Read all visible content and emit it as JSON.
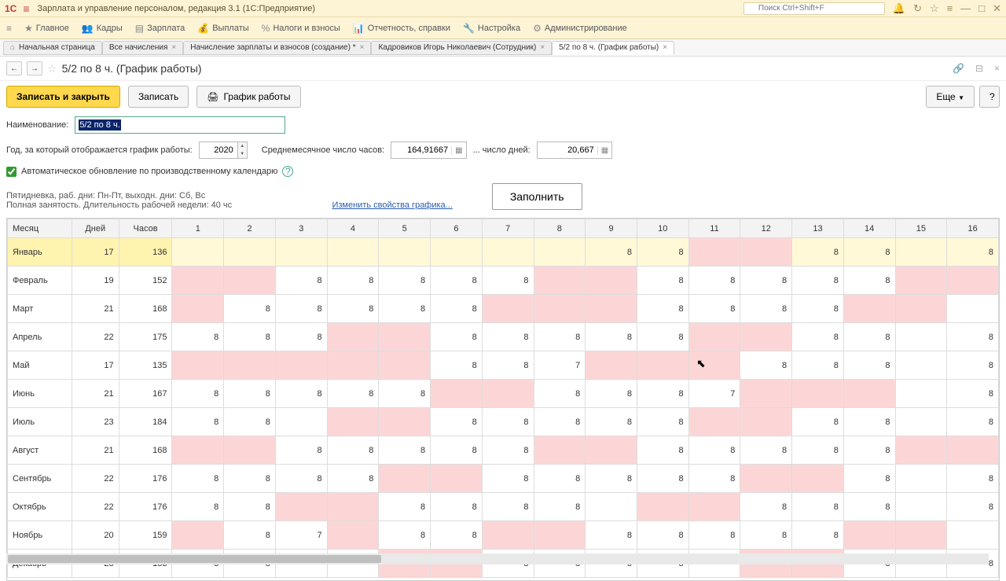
{
  "titlebar": {
    "title": "Зарплата и управление персоналом, редакция 3.1  (1С:Предприятие)",
    "search_placeholder": "Поиск Ctrl+Shift+F"
  },
  "menu": {
    "main": "Главное",
    "kadry": "Кадры",
    "zarplata": "Зарплата",
    "vyplaty": "Выплаты",
    "nalogi": "Налоги и взносы",
    "otchet": "Отчетность, справки",
    "nastr": "Настройка",
    "admin": "Администрирование"
  },
  "tabs": {
    "t0_label": "Начальная страница",
    "t1": "Все начисления",
    "t2": "Начисление зарплаты и взносов (создание) *",
    "t3": "Кадровиков Игорь Николаевич (Сотрудник)",
    "t4": "5/2 по 8 ч. (График работы)"
  },
  "page_title": "5/2 по 8 ч. (График работы)",
  "buttons": {
    "save_close": "Записать и закрыть",
    "save": "Записать",
    "schedule": "График работы",
    "more": "Еще",
    "help": "?",
    "fill": "Заполнить"
  },
  "labels": {
    "name": "Наименование:",
    "year": "Год, за который отображается график работы:",
    "avg_hours": "Среднемесячное число часов:",
    "avg_days": "... число дней:",
    "auto_update": "Автоматическое обновление по производственному календарю",
    "change_props": "Изменить свойства графика..."
  },
  "values": {
    "name": "5/2 по 8 ч.",
    "year": "2020",
    "avg_hours": "164,91667",
    "avg_days": "20,667"
  },
  "info": {
    "line1": "Пятидневка, раб. дни: Пн-Пт, выходн. дни: Сб, Вс",
    "line2": "Полная занятость. Длительность рабочей недели: 40 чс"
  },
  "headers": {
    "month": "Месяц",
    "days": "Дней",
    "hours": "Часов"
  },
  "day_cols": [
    "1",
    "2",
    "3",
    "4",
    "5",
    "6",
    "7",
    "8",
    "9",
    "10",
    "11",
    "12",
    "13",
    "14",
    "15",
    "16"
  ],
  "rows": [
    {
      "m": "Январь",
      "d": "17",
      "h": "136",
      "cells": [
        {
          "v": "",
          "w": false
        },
        {
          "v": "",
          "w": false
        },
        {
          "v": "",
          "w": false
        },
        {
          "v": "",
          "w": false
        },
        {
          "v": "",
          "w": false
        },
        {
          "v": "",
          "w": false
        },
        {
          "v": "",
          "w": false
        },
        {
          "v": "",
          "w": false
        },
        {
          "v": "8",
          "w": false
        },
        {
          "v": "8",
          "w": false
        },
        {
          "v": "",
          "w": true
        },
        {
          "v": "",
          "w": true
        },
        {
          "v": "8",
          "w": false
        },
        {
          "v": "8",
          "w": false
        },
        {
          "v": "",
          "w": false
        },
        {
          "v": "8",
          "w": false
        }
      ],
      "sel": true
    },
    {
      "m": "Февраль",
      "d": "19",
      "h": "152",
      "cells": [
        {
          "v": "",
          "w": true
        },
        {
          "v": "",
          "w": true
        },
        {
          "v": "8",
          "w": false
        },
        {
          "v": "8",
          "w": false
        },
        {
          "v": "8",
          "w": false
        },
        {
          "v": "8",
          "w": false
        },
        {
          "v": "8",
          "w": false
        },
        {
          "v": "",
          "w": true
        },
        {
          "v": "",
          "w": true
        },
        {
          "v": "8",
          "w": false
        },
        {
          "v": "8",
          "w": false
        },
        {
          "v": "8",
          "w": false
        },
        {
          "v": "8",
          "w": false
        },
        {
          "v": "8",
          "w": false
        },
        {
          "v": "",
          "w": true
        },
        {
          "v": "",
          "w": true
        }
      ]
    },
    {
      "m": "Март",
      "d": "21",
      "h": "168",
      "cells": [
        {
          "v": "",
          "w": true
        },
        {
          "v": "8",
          "w": false
        },
        {
          "v": "8",
          "w": false
        },
        {
          "v": "8",
          "w": false
        },
        {
          "v": "8",
          "w": false
        },
        {
          "v": "8",
          "w": false
        },
        {
          "v": "",
          "w": true
        },
        {
          "v": "",
          "w": true
        },
        {
          "v": "",
          "w": true
        },
        {
          "v": "8",
          "w": false
        },
        {
          "v": "8",
          "w": false
        },
        {
          "v": "8",
          "w": false
        },
        {
          "v": "8",
          "w": false
        },
        {
          "v": "",
          "w": true
        },
        {
          "v": "",
          "w": true
        },
        {
          "v": "",
          "w": false
        }
      ]
    },
    {
      "m": "Апрель",
      "d": "22",
      "h": "175",
      "cells": [
        {
          "v": "8",
          "w": false
        },
        {
          "v": "8",
          "w": false
        },
        {
          "v": "8",
          "w": false
        },
        {
          "v": "",
          "w": true
        },
        {
          "v": "",
          "w": true
        },
        {
          "v": "8",
          "w": false
        },
        {
          "v": "8",
          "w": false
        },
        {
          "v": "8",
          "w": false
        },
        {
          "v": "8",
          "w": false
        },
        {
          "v": "8",
          "w": false
        },
        {
          "v": "",
          "w": true
        },
        {
          "v": "",
          "w": true
        },
        {
          "v": "8",
          "w": false
        },
        {
          "v": "8",
          "w": false
        },
        {
          "v": "",
          "w": false
        },
        {
          "v": "8",
          "w": false
        }
      ]
    },
    {
      "m": "Май",
      "d": "17",
      "h": "135",
      "cells": [
        {
          "v": "",
          "w": true
        },
        {
          "v": "",
          "w": true
        },
        {
          "v": "",
          "w": true
        },
        {
          "v": "",
          "w": true
        },
        {
          "v": "",
          "w": true
        },
        {
          "v": "8",
          "w": false
        },
        {
          "v": "8",
          "w": false
        },
        {
          "v": "7",
          "w": false
        },
        {
          "v": "",
          "w": true
        },
        {
          "v": "",
          "w": true
        },
        {
          "v": "",
          "w": true
        },
        {
          "v": "8",
          "w": false
        },
        {
          "v": "8",
          "w": false
        },
        {
          "v": "8",
          "w": false
        },
        {
          "v": "",
          "w": false
        },
        {
          "v": "8",
          "w": false
        }
      ]
    },
    {
      "m": "Июнь",
      "d": "21",
      "h": "167",
      "cells": [
        {
          "v": "8",
          "w": false
        },
        {
          "v": "8",
          "w": false
        },
        {
          "v": "8",
          "w": false
        },
        {
          "v": "8",
          "w": false
        },
        {
          "v": "8",
          "w": false
        },
        {
          "v": "",
          "w": true
        },
        {
          "v": "",
          "w": true
        },
        {
          "v": "8",
          "w": false
        },
        {
          "v": "8",
          "w": false
        },
        {
          "v": "8",
          "w": false
        },
        {
          "v": "7",
          "w": false
        },
        {
          "v": "",
          "w": true
        },
        {
          "v": "",
          "w": true
        },
        {
          "v": "",
          "w": true
        },
        {
          "v": "",
          "w": false
        },
        {
          "v": "8",
          "w": false
        }
      ]
    },
    {
      "m": "Июль",
      "d": "23",
      "h": "184",
      "cells": [
        {
          "v": "8",
          "w": false
        },
        {
          "v": "8",
          "w": false
        },
        {
          "v": "",
          "w": false
        },
        {
          "v": "",
          "w": true
        },
        {
          "v": "",
          "w": true
        },
        {
          "v": "8",
          "w": false
        },
        {
          "v": "8",
          "w": false
        },
        {
          "v": "8",
          "w": false
        },
        {
          "v": "8",
          "w": false
        },
        {
          "v": "8",
          "w": false
        },
        {
          "v": "",
          "w": true
        },
        {
          "v": "",
          "w": true
        },
        {
          "v": "8",
          "w": false
        },
        {
          "v": "8",
          "w": false
        },
        {
          "v": "",
          "w": false
        },
        {
          "v": "8",
          "w": false
        }
      ]
    },
    {
      "m": "Август",
      "d": "21",
      "h": "168",
      "cells": [
        {
          "v": "",
          "w": true
        },
        {
          "v": "",
          "w": true
        },
        {
          "v": "8",
          "w": false
        },
        {
          "v": "8",
          "w": false
        },
        {
          "v": "8",
          "w": false
        },
        {
          "v": "8",
          "w": false
        },
        {
          "v": "8",
          "w": false
        },
        {
          "v": "",
          "w": true
        },
        {
          "v": "",
          "w": true
        },
        {
          "v": "8",
          "w": false
        },
        {
          "v": "8",
          "w": false
        },
        {
          "v": "8",
          "w": false
        },
        {
          "v": "8",
          "w": false
        },
        {
          "v": "8",
          "w": false
        },
        {
          "v": "",
          "w": true
        },
        {
          "v": "",
          "w": true
        }
      ]
    },
    {
      "m": "Сентябрь",
      "d": "22",
      "h": "176",
      "cells": [
        {
          "v": "8",
          "w": false
        },
        {
          "v": "8",
          "w": false
        },
        {
          "v": "8",
          "w": false
        },
        {
          "v": "8",
          "w": false
        },
        {
          "v": "",
          "w": true
        },
        {
          "v": "",
          "w": true
        },
        {
          "v": "8",
          "w": false
        },
        {
          "v": "8",
          "w": false
        },
        {
          "v": "8",
          "w": false
        },
        {
          "v": "8",
          "w": false
        },
        {
          "v": "8",
          "w": false
        },
        {
          "v": "",
          "w": true
        },
        {
          "v": "",
          "w": true
        },
        {
          "v": "8",
          "w": false
        },
        {
          "v": "",
          "w": false
        },
        {
          "v": "8",
          "w": false
        }
      ]
    },
    {
      "m": "Октябрь",
      "d": "22",
      "h": "176",
      "cells": [
        {
          "v": "8",
          "w": false
        },
        {
          "v": "8",
          "w": false
        },
        {
          "v": "",
          "w": true
        },
        {
          "v": "",
          "w": true
        },
        {
          "v": "8",
          "w": false
        },
        {
          "v": "8",
          "w": false
        },
        {
          "v": "8",
          "w": false
        },
        {
          "v": "8",
          "w": false
        },
        {
          "v": "",
          "w": false
        },
        {
          "v": "",
          "w": true
        },
        {
          "v": "",
          "w": true
        },
        {
          "v": "8",
          "w": false
        },
        {
          "v": "8",
          "w": false
        },
        {
          "v": "8",
          "w": false
        },
        {
          "v": "",
          "w": false
        },
        {
          "v": "8",
          "w": false
        }
      ]
    },
    {
      "m": "Ноябрь",
      "d": "20",
      "h": "159",
      "cells": [
        {
          "v": "",
          "w": true
        },
        {
          "v": "8",
          "w": false
        },
        {
          "v": "7",
          "w": false
        },
        {
          "v": "",
          "w": true
        },
        {
          "v": "8",
          "w": false
        },
        {
          "v": "8",
          "w": false
        },
        {
          "v": "",
          "w": true
        },
        {
          "v": "",
          "w": true
        },
        {
          "v": "8",
          "w": false
        },
        {
          "v": "8",
          "w": false
        },
        {
          "v": "8",
          "w": false
        },
        {
          "v": "8",
          "w": false
        },
        {
          "v": "8",
          "w": false
        },
        {
          "v": "",
          "w": true
        },
        {
          "v": "",
          "w": true
        },
        {
          "v": "",
          "w": false
        }
      ]
    },
    {
      "m": "Декабрь",
      "d": "23",
      "h": "183",
      "cells": [
        {
          "v": "8",
          "w": false
        },
        {
          "v": "8",
          "w": false
        },
        {
          "v": "",
          "w": false
        },
        {
          "v": "",
          "w": false
        },
        {
          "v": "",
          "w": true
        },
        {
          "v": "",
          "w": true
        },
        {
          "v": "8",
          "w": false
        },
        {
          "v": "8",
          "w": false
        },
        {
          "v": "8",
          "w": false
        },
        {
          "v": "8",
          "w": false
        },
        {
          "v": "",
          "w": false
        },
        {
          "v": "",
          "w": true
        },
        {
          "v": "",
          "w": true
        },
        {
          "v": "8",
          "w": false
        },
        {
          "v": "",
          "w": false
        },
        {
          "v": "8",
          "w": false
        }
      ]
    }
  ]
}
